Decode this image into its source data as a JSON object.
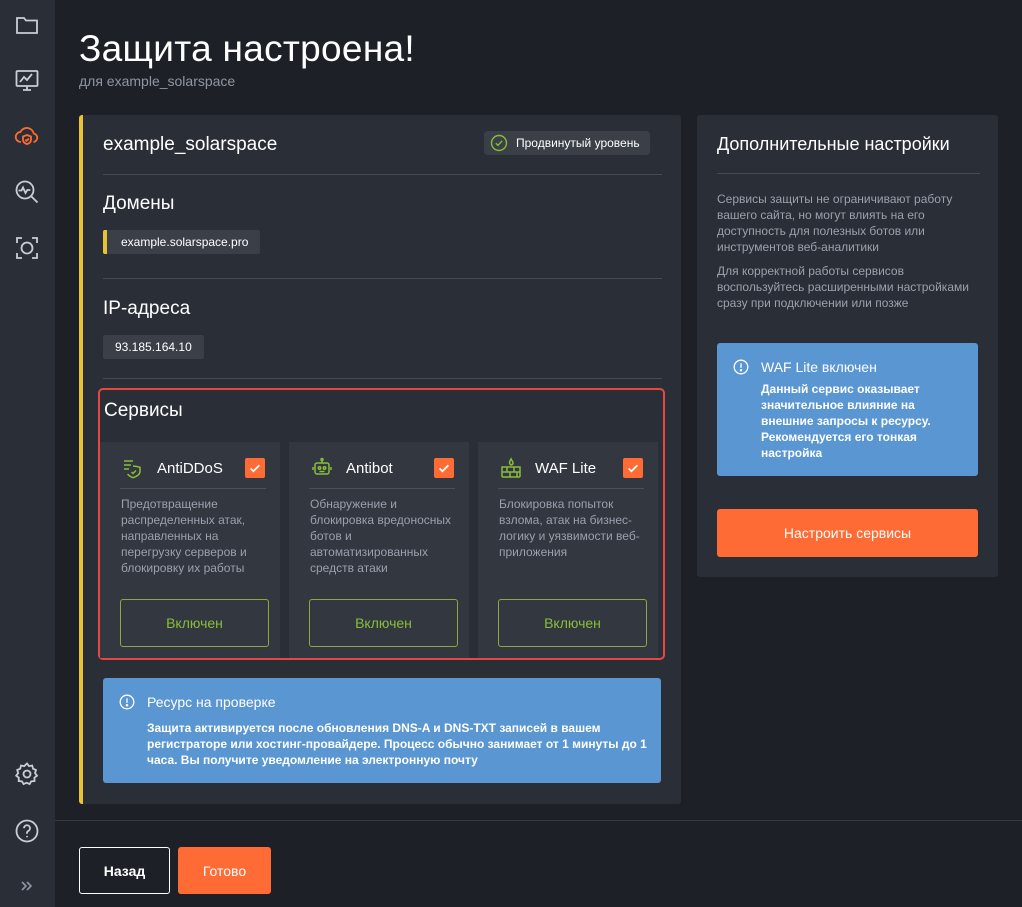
{
  "page": {
    "title": "Защита настроена!",
    "subtitle": "для example_solarspace"
  },
  "sidebar": {
    "icons": [
      "folder-icon",
      "monitor-chart-icon",
      "cloud-shield-icon",
      "search-pulse-icon",
      "scan-icon",
      "gear-icon",
      "help-icon",
      "expand-icon"
    ],
    "active": "cloud-shield-icon",
    "accent_color": "#ff6b35"
  },
  "resource": {
    "name": "example_solarspace",
    "level_badge": "Продвинутый уровень",
    "domains_title": "Домены",
    "domains": [
      "example.solarspace.pro"
    ],
    "ips_title": "IP-адреса",
    "ips": [
      "93.185.164.10"
    ]
  },
  "services": {
    "title": "Сервисы",
    "items": [
      {
        "name": "AntiDDoS",
        "icon": "antiddos-icon",
        "checked": true,
        "description": "Предотвращение распределенных атак, направленных на перегрузку серверов и блокировку их работы",
        "button": "Включен"
      },
      {
        "name": "Antibot",
        "icon": "robot-icon",
        "checked": true,
        "description": "Обнаружение и блокировка вредоносных ботов и автоматизированных средств атаки",
        "button": "Включен"
      },
      {
        "name": "WAF Lite",
        "icon": "firewall-icon",
        "checked": true,
        "description": "Блокировка попыток взлома, атак на бизнес-логику и уязвимости веб-приложения",
        "button": "Включен"
      }
    ]
  },
  "check_notice": {
    "title": "Ресурс на проверке",
    "text": "Защита активируется после обновления DNS-A и DNS-TXT записей в вашем регистраторе или хостинг-провайдере. Процесс обычно занимает от 1 минуты до 1 часа. Вы получите уведомление на электронную почту"
  },
  "extra_settings": {
    "title": "Дополнительные настройки",
    "paragraph1": "Сервисы защиты не ограничивают работу вашего сайта, но могут влиять на его доступность для полезных ботов или инструментов веб-аналитики",
    "paragraph2": "Для корректной работы сервисов воспользуйтесь расширенными настройками сразу при подключении или позже",
    "waf_notice_title": "WAF Lite включен",
    "waf_notice_text": "Данный сервис оказывает значительное влияние на внешние запросы к ресурсу. Рекомендуется его тонкая настройка",
    "configure_button": "Настроить сервисы"
  },
  "footer": {
    "back_button": "Назад",
    "done_button": "Готово"
  },
  "colors": {
    "background": "#1d2027",
    "card": "#2a2f37",
    "accent_orange": "#ff6b35",
    "accent_yellow": "#e8c334",
    "enabled_green": "#8bbd3a",
    "info_blue": "#5a96d2",
    "highlight_red": "#e8473f"
  }
}
